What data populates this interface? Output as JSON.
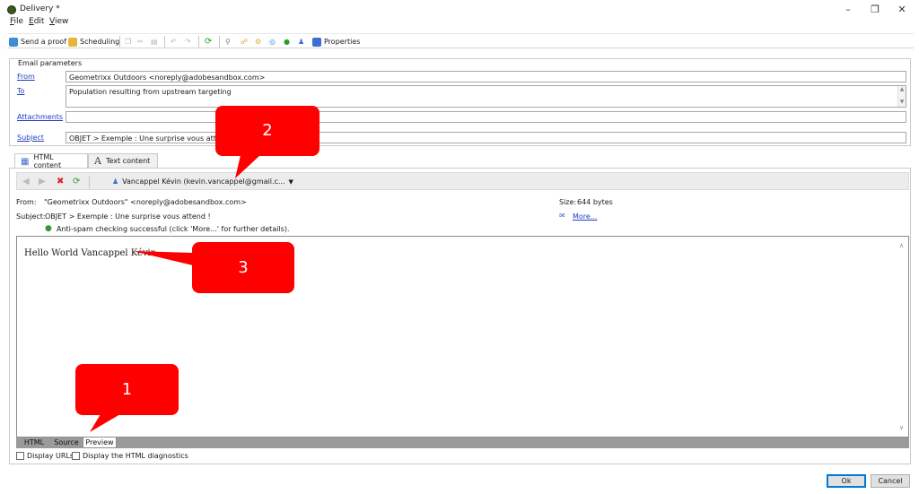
{
  "window": {
    "title": "Delivery *",
    "controls": {
      "minimize": "–",
      "maximize": "❐",
      "close": "✕"
    }
  },
  "menu": [
    {
      "label": "File",
      "accel": "F",
      "rest": "ile"
    },
    {
      "label": "Edit",
      "accel": "E",
      "rest": "dit"
    },
    {
      "label": "View",
      "accel": "V",
      "rest": "iew"
    }
  ],
  "toolbar": {
    "send_proof": "Send a proof",
    "scheduling": "Scheduling",
    "properties": "Properties"
  },
  "email_params": {
    "group_title": "Email parameters",
    "from_label": "From",
    "from_value": "Geometrixx Outdoors <noreply@adobesandbox.com>",
    "to_label": "To",
    "to_value": "Population resulting from upstream targeting",
    "attachments_label": "Attachments",
    "attachments_value": "",
    "subject_label": "Subject",
    "subject_value": "OBJET > Exemple : Une surprise vous attend !"
  },
  "tabs": {
    "html_content": "HTML content",
    "text_content": "Text content"
  },
  "preview_toolbar": {
    "recipient": "Vancappel Kévin (kevin.vancappel@gmail.c..."
  },
  "message_info": {
    "from_label": "From:",
    "from_value": "\"Geometrixx Outdoors\" <noreply@adobesandbox.com>",
    "subject_label": "Subject:",
    "subject_value": "OBJET > Exemple : Une surprise vous attend !",
    "antispam": "Anti-spam checking successful (click 'More...' for further details).",
    "size_label": "Size:",
    "size_value": "644 bytes",
    "more": "More..."
  },
  "preview": {
    "body_text": "Hello World Vancappel Kévin"
  },
  "bottom_tabs": {
    "html": "HTML",
    "source": "Source",
    "preview": "Preview"
  },
  "options": {
    "display_urls": "Display URLs",
    "display_diagnostics": "Display the HTML diagnostics"
  },
  "buttons": {
    "ok": "Ok",
    "cancel": "Cancel"
  },
  "callouts": {
    "one": "1",
    "two": "2",
    "three": "3"
  },
  "colors": {
    "callout": "#ff0000",
    "link": "#1f3fbf",
    "bottom_tab_bar": "#9a9a9a"
  }
}
